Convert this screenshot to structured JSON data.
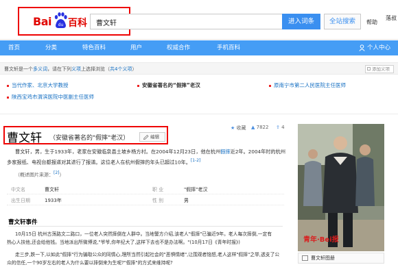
{
  "search": {
    "logo_bai": "Bai",
    "logo_du": "du",
    "logo_baike": "百科",
    "query": "曹文轩",
    "enter_button": "进入词条",
    "all_search_button": "全站搜索",
    "help": "帮助",
    "user_name": "落叔"
  },
  "nav": {
    "items": [
      "首页",
      "分类",
      "特色百科",
      "用户",
      "权威合作",
      "手机百科"
    ],
    "personal_center": "个人中心"
  },
  "polysemy": {
    "notice_prefix": "曹文轩是一个",
    "notice_link": "多义词",
    "notice_middle": "，请在下列",
    "notice_item": "义项",
    "notice_middle2": "上选择浏览（",
    "notice_count": "共4个义项",
    "notice_suffix": "）",
    "add_button": "添加义项",
    "items": [
      "当代作家、北京大学教授",
      "安徽省著名的“假摔”老汉",
      "原南宁市第二人民医院主任医师",
      "陕西宝鸡市渭滨医院中医副主任医师"
    ]
  },
  "entry": {
    "title": "曹文轩",
    "subtitle": "（安徽省著名的\"假摔\"老汉）",
    "edit_button": "编辑",
    "collect": "收藏",
    "like_count": "7822",
    "share_count": "4",
    "para1_line1": "曹文轩，男，生于1933年，老家在安徽临泉县土坡乡杨方村。在2004年12月23日，他在杭州",
    "para1_link": "假摔",
    "para1_line1_end": "近2年。2004年时的杭州",
    "para1_line2": "多家报纸、电视台都报道对其进行了报道。这位老人在杭州假摔的年头已超过10年。",
    "para1_ref": "[1-2]",
    "image_hint": "（概述图片来源：",
    "image_hint_ref": "[2]",
    "image_hint_end": "）",
    "info": [
      {
        "key": "中文名",
        "value": "曹文轩"
      },
      {
        "key": "职    业",
        "value": "\"假摔\"老汉"
      },
      {
        "key": "出生日期",
        "value": "1933年"
      },
      {
        "key": "性    别",
        "value": "男"
      }
    ],
    "section_title": "曹文轩事件",
    "p2_line1": "10月15日 杭州古荡路文二路口，一位老人突然摔倒在人群中。当地警方介绍,该老人\"假摔\"已骗近9年。老人每次摔倒,一定有",
    "p2_line2": "热心人扶他,还会给他钱。当地派出所微博说,\"爷爷,你年纪大了,这样下去也不是办法啊。\"(10月17日《青年时报》)",
    "p3_line1": "走三步,跌一下,以如此\"假摔\"行为骗取公众的同情心,理所当然引起社会的\"恶惧情绪\",让围观者恼怒,老人这样\"假摔\"之举,透支了公",
    "p3_line2": "众的信任,一个90岁左右的老人为什么要以摔倒来为生呢?\"假摔\"的方式来维持呢?",
    "photo_caption": "曹文轩图册",
    "photo_watermark": "青年·Bei报"
  }
}
